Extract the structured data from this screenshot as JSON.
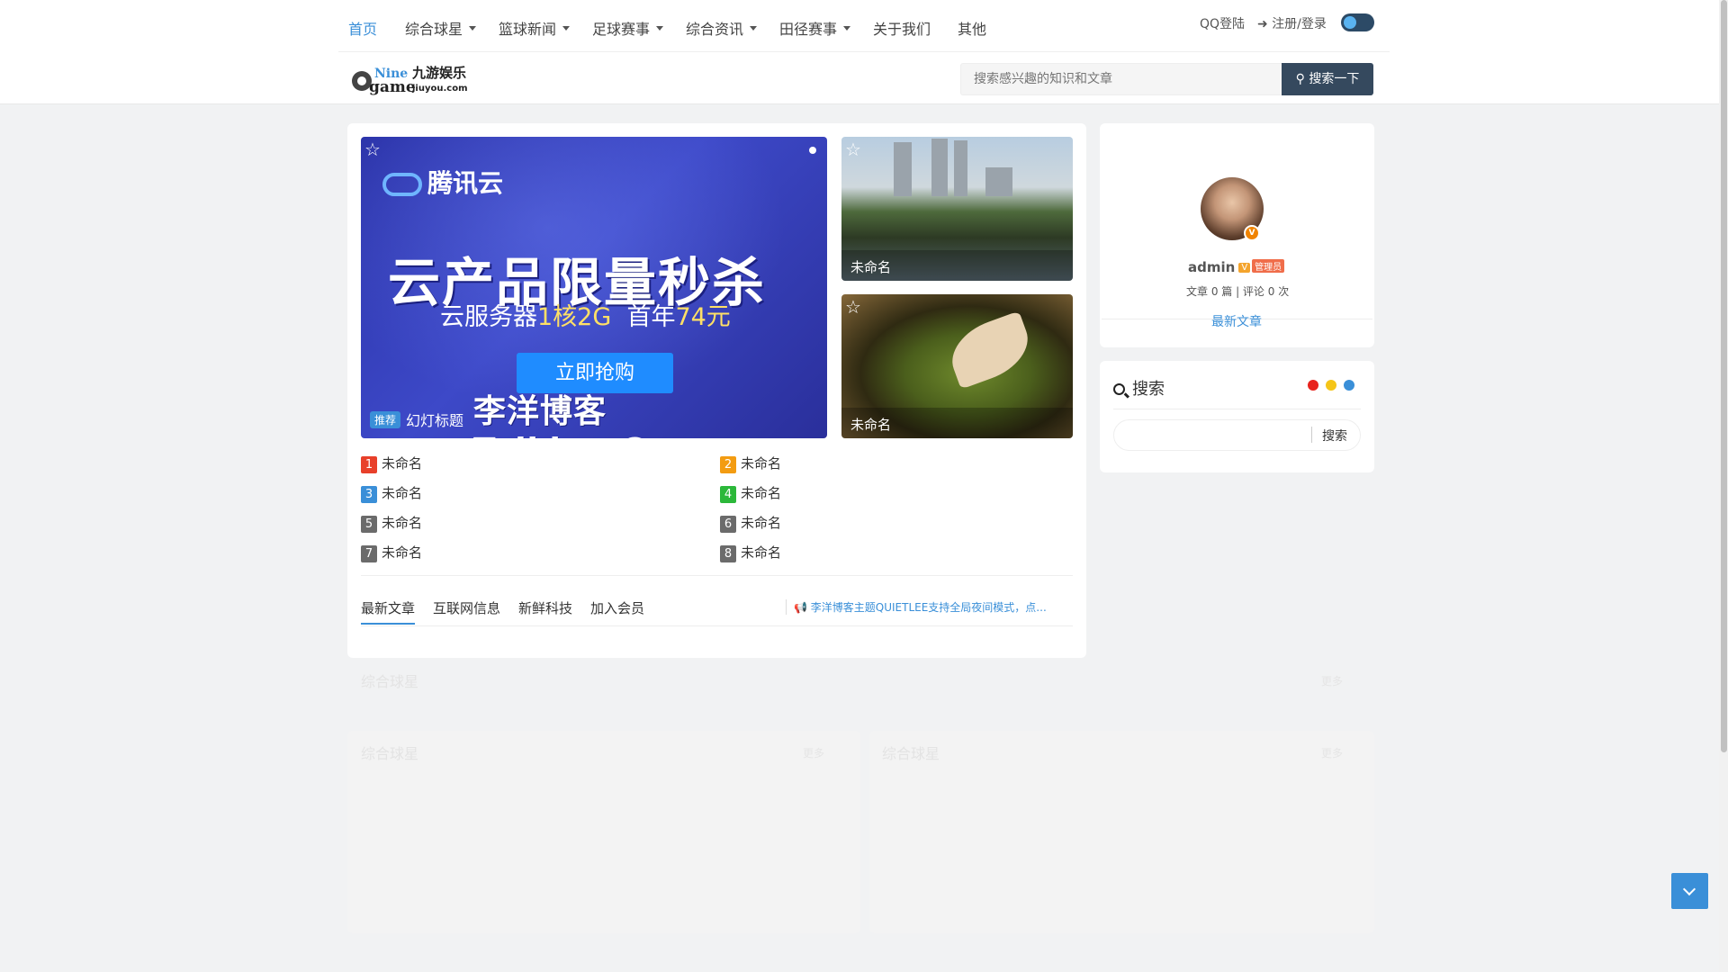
{
  "nav": {
    "items": [
      {
        "label": "首页",
        "active": true,
        "dropdown": false
      },
      {
        "label": "综合球星",
        "active": false,
        "dropdown": true
      },
      {
        "label": "篮球新闻",
        "active": false,
        "dropdown": true
      },
      {
        "label": "足球赛事",
        "active": false,
        "dropdown": true
      },
      {
        "label": "综合资讯",
        "active": false,
        "dropdown": true
      },
      {
        "label": "田径赛事",
        "active": false,
        "dropdown": true
      },
      {
        "label": "关于我们",
        "active": false,
        "dropdown": false
      },
      {
        "label": "其他",
        "active": false,
        "dropdown": false
      }
    ],
    "qq_login": "QQ登陆",
    "register_login": "注册/登录",
    "night_mode_toggle": true
  },
  "logo": {
    "text_top": "Nine",
    "text_bottom": "game",
    "brand_cn": "九游娱乐",
    "domain": "jiuyou.com"
  },
  "search": {
    "placeholder": "搜索感兴趣的知识和文章",
    "button_label": "搜索一下"
  },
  "slider": {
    "brand": "腾讯云",
    "headline": "云产品限量秒杀",
    "sub_prefix": "云服务器",
    "sub_highlight": "1核2G",
    "sub_suffix": "首年",
    "sub_price": "74元",
    "button": "立即抢购",
    "watermark": "李洋博客Talklee.Com",
    "tag": "推荐",
    "caption": "幻灯标题"
  },
  "thumbs": [
    {
      "caption": "未命名"
    },
    {
      "caption": "未命名"
    }
  ],
  "ranking": [
    {
      "num": "1",
      "title": "未命名",
      "color": "#e8402a"
    },
    {
      "num": "2",
      "title": "未命名",
      "color": "#f39c12"
    },
    {
      "num": "3",
      "title": "未命名",
      "color": "#3a8fd8"
    },
    {
      "num": "4",
      "title": "未命名",
      "color": "#2cb83a"
    },
    {
      "num": "5",
      "title": "未命名",
      "color": "#6b6b6b"
    },
    {
      "num": "6",
      "title": "未命名",
      "color": "#6b6b6b"
    },
    {
      "num": "7",
      "title": "未命名",
      "color": "#6b6b6b"
    },
    {
      "num": "8",
      "title": "未命名",
      "color": "#6b6b6b"
    }
  ],
  "tabs": [
    {
      "label": "最新文章",
      "active": true
    },
    {
      "label": "互联网信息",
      "active": false
    },
    {
      "label": "新鲜科技",
      "active": false
    },
    {
      "label": "加入会员",
      "active": false
    }
  ],
  "notice": "李洋博客主题QUIETLEE支持全局夜间模式，点...",
  "profile": {
    "name": "admin",
    "badge_v": "V",
    "badge_role": "管理员",
    "avatar_badge": "V",
    "stats": "文章 0 篇 | 评论 0 次",
    "latest_link": "最新文章"
  },
  "search_widget": {
    "title": "搜索",
    "button": "搜索",
    "dot_colors": [
      "#e8231d",
      "#f5c518",
      "#3a8fd8"
    ]
  },
  "faded_sections": {
    "section1_title": "综合球星",
    "section2_left_title": "综合球星",
    "section2_right_title": "综合球星",
    "more": "更多"
  },
  "colors": {
    "accent": "#3a8fd8",
    "search_button": "#35495e",
    "page_bg": "#f1f2f3"
  }
}
